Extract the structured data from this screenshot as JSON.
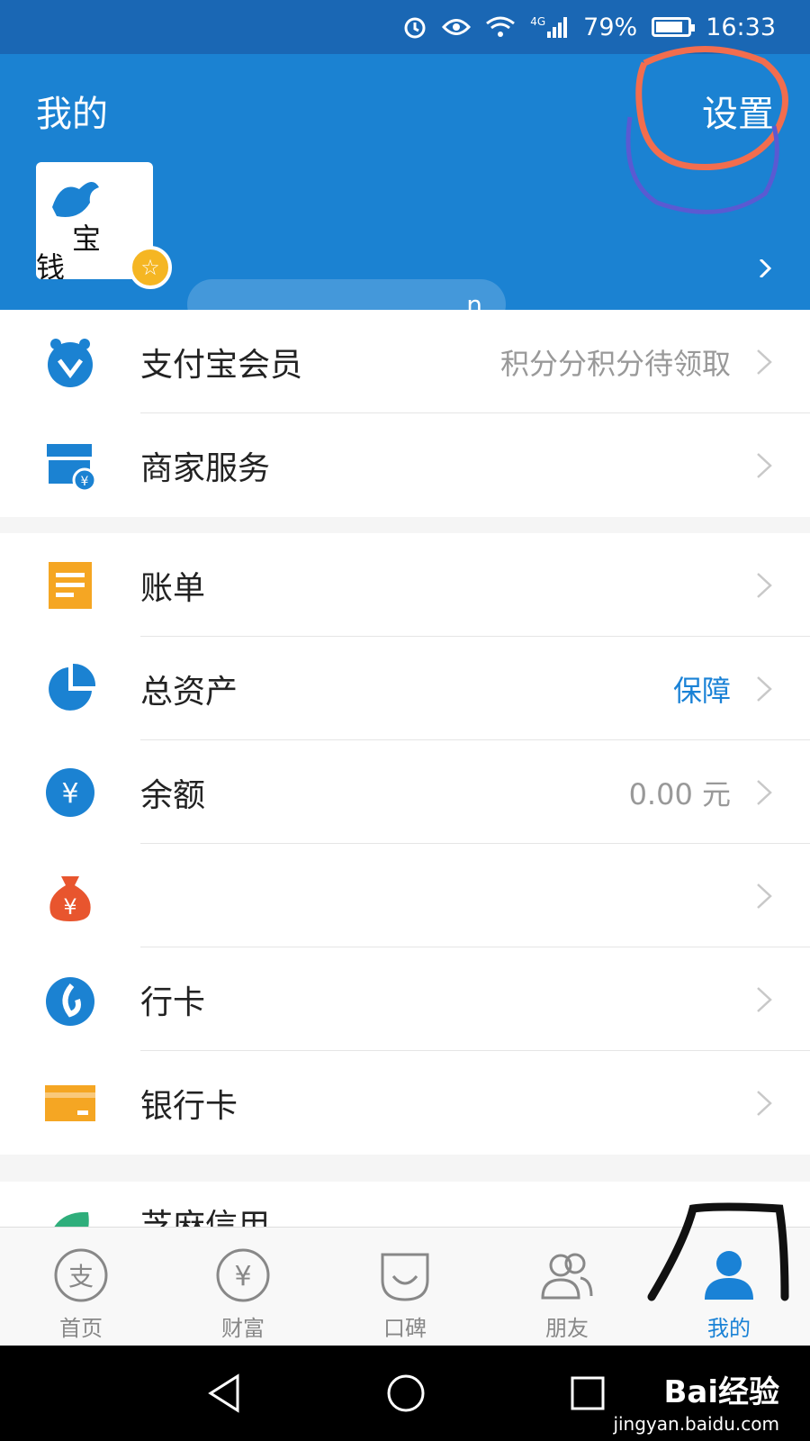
{
  "status_bar": {
    "battery": "79%",
    "time": "16:33",
    "network": "4G"
  },
  "header": {
    "title": "我的",
    "settings_label": "设置",
    "account_suffix": "n",
    "avatar_text_1": "宝",
    "avatar_text_2": "钱"
  },
  "sections": [
    {
      "items": [
        {
          "label": "支付宝会员",
          "value": "积分分积分待领取",
          "icon": "member-icon"
        },
        {
          "label": "商家服务",
          "value": "",
          "icon": "store-icon"
        }
      ]
    },
    {
      "items": [
        {
          "label": "账单",
          "value": "",
          "icon": "bill-icon"
        },
        {
          "label": "总资产",
          "value": "保障",
          "icon": "pie-chart-icon"
        },
        {
          "label": "余额",
          "value": "0.00 元",
          "icon": "yuan-icon"
        },
        {
          "label": "",
          "value": "",
          "icon": "money-bag-icon"
        },
        {
          "label": "行卡",
          "value": "",
          "icon": "huabei-icon"
        },
        {
          "label": "银行卡",
          "value": "",
          "icon": "bank-card-icon"
        }
      ]
    },
    {
      "items": [
        {
          "label": "芝麻信用",
          "value": "",
          "icon": "sesame-icon"
        }
      ]
    }
  ],
  "tabs": [
    {
      "label": "首页",
      "icon": "alipay-icon"
    },
    {
      "label": "财富",
      "icon": "wealth-icon"
    },
    {
      "label": "口碑",
      "icon": "koubei-icon"
    },
    {
      "label": "朋友",
      "icon": "friends-icon"
    },
    {
      "label": "我的",
      "icon": "person-icon",
      "active": true
    }
  ],
  "watermark": {
    "brand": "Bai经验",
    "url": "jingyan.baidu.com"
  },
  "colors": {
    "header_blue": "#1b82d2",
    "status_blue": "#1a67b4",
    "accent_blue": "#1a82d6",
    "orange": "#f5a623"
  }
}
